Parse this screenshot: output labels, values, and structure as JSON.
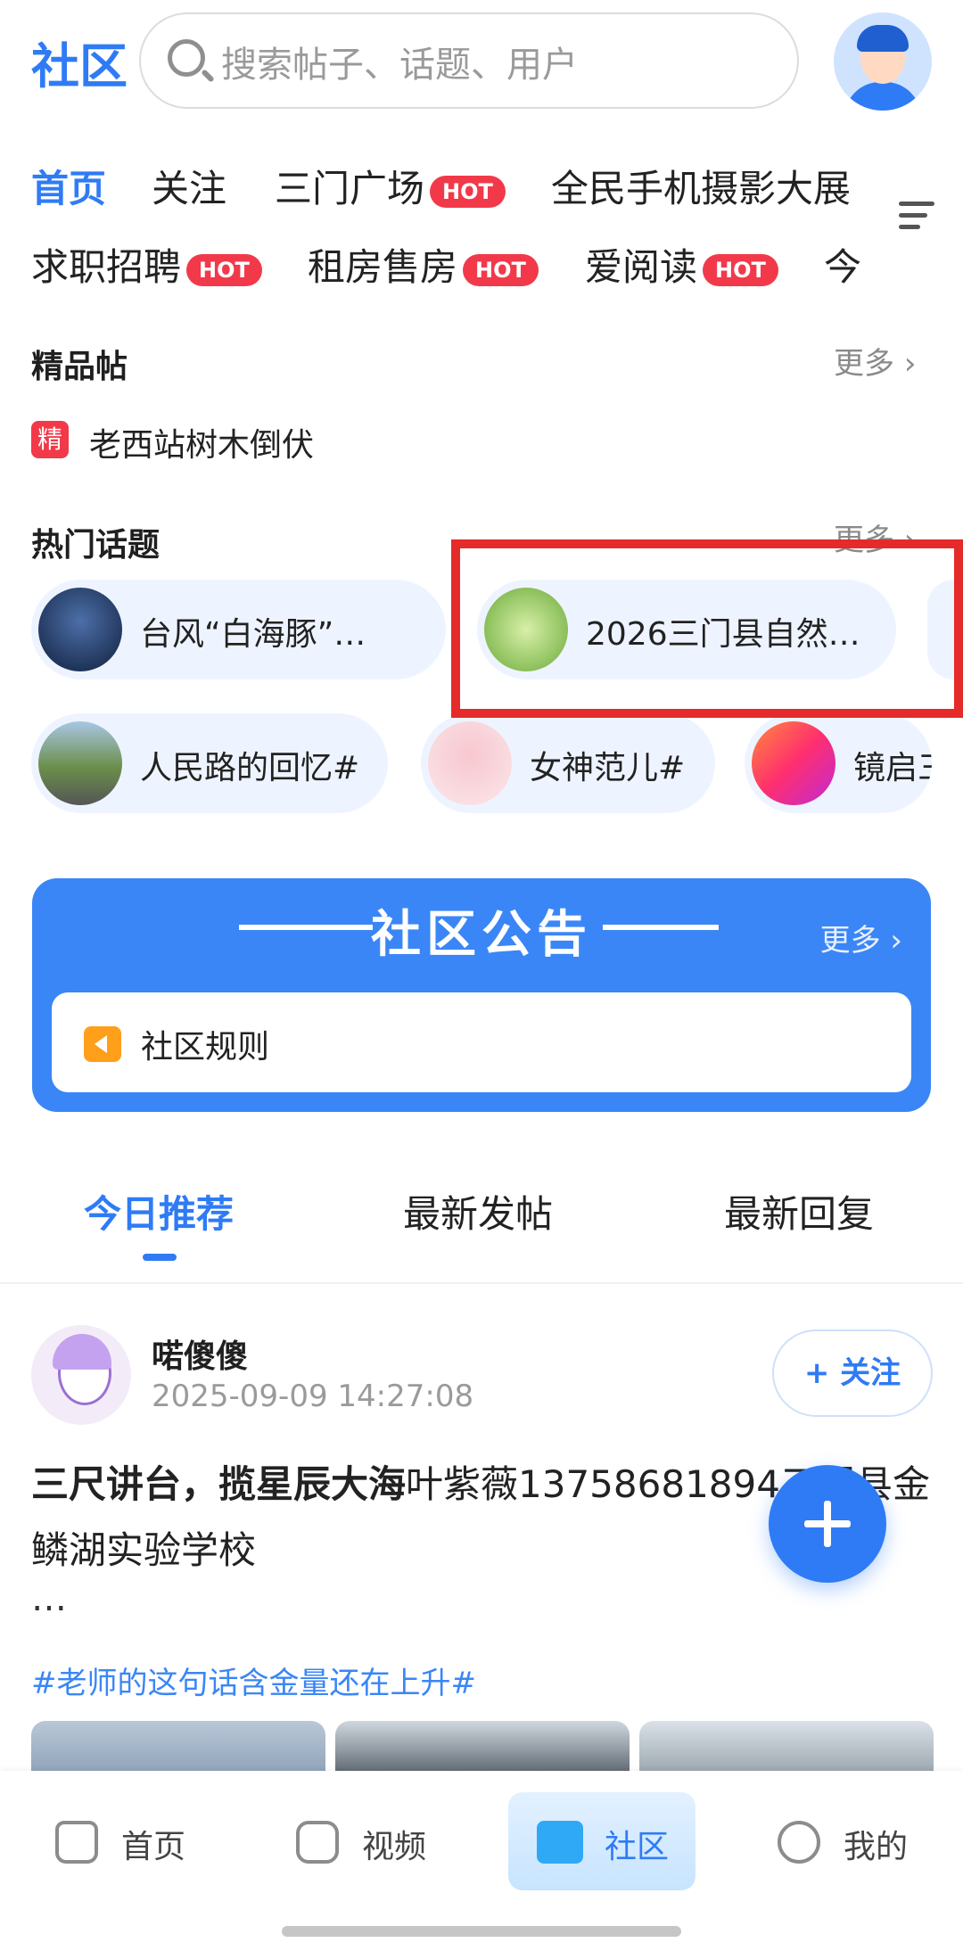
{
  "header": {
    "title": "社区",
    "search_placeholder": "搜索帖子、话题、用户"
  },
  "tabs": {
    "row1": [
      "首页",
      "关注",
      "三门广场",
      "全民手机摄影大展"
    ],
    "row2": [
      "求职招聘",
      "租房售房",
      "爱阅读",
      "今"
    ],
    "hot_label": "HOT"
  },
  "essence": {
    "title": "精品帖",
    "more": "更多",
    "badge": "精",
    "item": "老西站树木倒伏"
  },
  "hot_topics": {
    "title": "热门话题",
    "more": "更多",
    "items": [
      "台风“白海豚”…",
      "2026三门县自然…",
      "人民路的回忆#",
      "女神范儿#",
      "镜启三"
    ]
  },
  "notice": {
    "title": "社区公告",
    "more": "更多",
    "item": "社区规则"
  },
  "feed_tabs": [
    "今日推荐",
    "最新发帖",
    "最新回复"
  ],
  "post": {
    "author": "喏傻傻",
    "time": "2025-09-09 14:27:08",
    "follow": "+ 关注",
    "title_bold": "三尺讲台，揽星辰大海",
    "text": "叶紫薇13758681894三门县金鳞湖实验学校",
    "ellipsis": "…",
    "topic": "#老师的这句话含金量还在上升#"
  },
  "bottom_nav": [
    "首页",
    "视频",
    "社区",
    "我的"
  ],
  "colors": {
    "accent": "#2f7bf5",
    "hot": "#f2394a",
    "highlight": "#e52a2a"
  }
}
